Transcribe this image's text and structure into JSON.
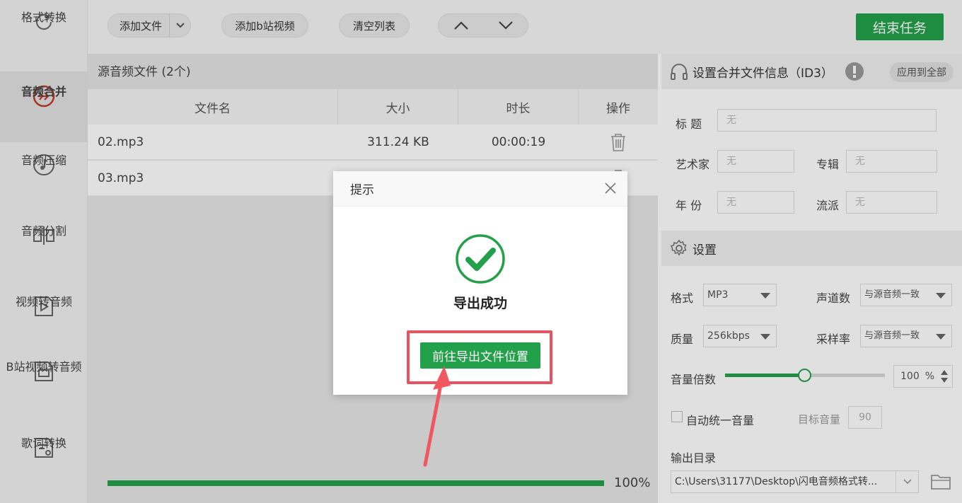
{
  "sidebar": {
    "items": [
      {
        "label": "格式转换",
        "icon": "refresh-icon"
      },
      {
        "label": "音频合并",
        "icon": "merge-icon",
        "active": true
      },
      {
        "label": "音频压缩",
        "icon": "music-note-icon"
      },
      {
        "label": "音频分割",
        "icon": "split-icon"
      },
      {
        "label": "视频转音频",
        "icon": "video-play-icon"
      },
      {
        "label": "B站视频转音频",
        "icon": "bilibili-tv-icon"
      },
      {
        "label": "歌词转换",
        "icon": "lyrics-icon"
      }
    ],
    "active_color": "#c0392b"
  },
  "toolbar": {
    "add_file": "添加文件",
    "add_bili": "添加b站视频",
    "clear_list": "清空列表",
    "end_task": "结束任务",
    "accent": "#23a04a"
  },
  "filelist": {
    "title": "源音频文件 (2个)",
    "columns": [
      "文件名",
      "大小",
      "时长",
      "操作"
    ],
    "rows": [
      {
        "name": "02.mp3",
        "size": "311.24 KB",
        "duration": "00:00:19"
      },
      {
        "name": "03.mp3",
        "size": "",
        "duration": ""
      }
    ]
  },
  "progress": {
    "percent": 100,
    "text": "100%"
  },
  "id3": {
    "heading": "设置合并文件信息（ID3）",
    "apply_all": "应用到全部",
    "title_label": "标  题",
    "artist_label": "艺术家",
    "album_label": "专辑",
    "year_label": "年  份",
    "genre_label": "流派",
    "placeholder": "无"
  },
  "settings": {
    "heading": "设置",
    "format_label": "格式",
    "format_value": "MP3",
    "channels_label": "声道数",
    "channels_value": "与源音频一致",
    "quality_label": "质量",
    "quality_value": "256kbps",
    "samplerate_label": "采样率",
    "samplerate_value": "与源音频一致",
    "volume_label": "音量倍数",
    "volume_value": "100",
    "volume_unit": "%",
    "volume_level": 0.5,
    "auto_volume_label": "自动统一音量",
    "target_volume_label": "目标音量",
    "target_volume_value": "90",
    "output_label": "输出目录",
    "output_path": "C:\\Users\\31177\\Desktop\\闪电音频格式转..."
  },
  "dialog": {
    "title": "提示",
    "message": "导出成功",
    "button": "前往导出文件位置",
    "highlight_color": "#e9525e"
  }
}
